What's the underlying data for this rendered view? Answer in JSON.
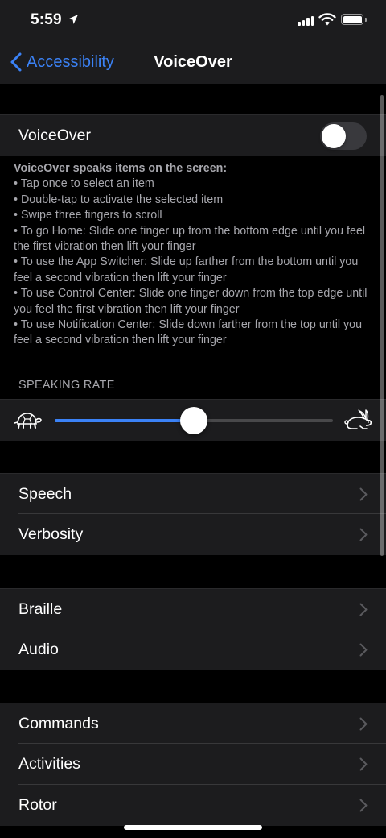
{
  "status": {
    "time": "5:59"
  },
  "nav": {
    "back_label": "Accessibility",
    "title": "VoiceOver"
  },
  "voiceover": {
    "label": "VoiceOver",
    "enabled": false
  },
  "description": {
    "heading": "VoiceOver speaks items on the screen:",
    "lines": [
      "• Tap once to select an item",
      "• Double-tap to activate the selected item",
      "• Swipe three fingers to scroll",
      "• To go Home: Slide one finger up from the bottom edge until you feel the first vibration then lift your finger",
      "• To use the App Switcher: Slide up farther from the bottom until you feel a second vibration then lift your finger",
      "• To use Control Center: Slide one finger down from the top edge until you feel the first vibration then lift your finger",
      "• To use Notification Center: Slide down farther from the top until you feel a second vibration then lift your finger"
    ]
  },
  "speaking_rate": {
    "header": "SPEAKING RATE",
    "value_fraction": 0.5
  },
  "groups": {
    "group1": [
      "Speech",
      "Verbosity"
    ],
    "group2": [
      "Braille",
      "Audio"
    ],
    "group3": [
      "Commands",
      "Activities",
      "Rotor"
    ]
  },
  "colors": {
    "accent": "#3b82f6",
    "background": "#000000",
    "cell": "#1c1c1e",
    "secondary_text": "#a7a7ad"
  }
}
